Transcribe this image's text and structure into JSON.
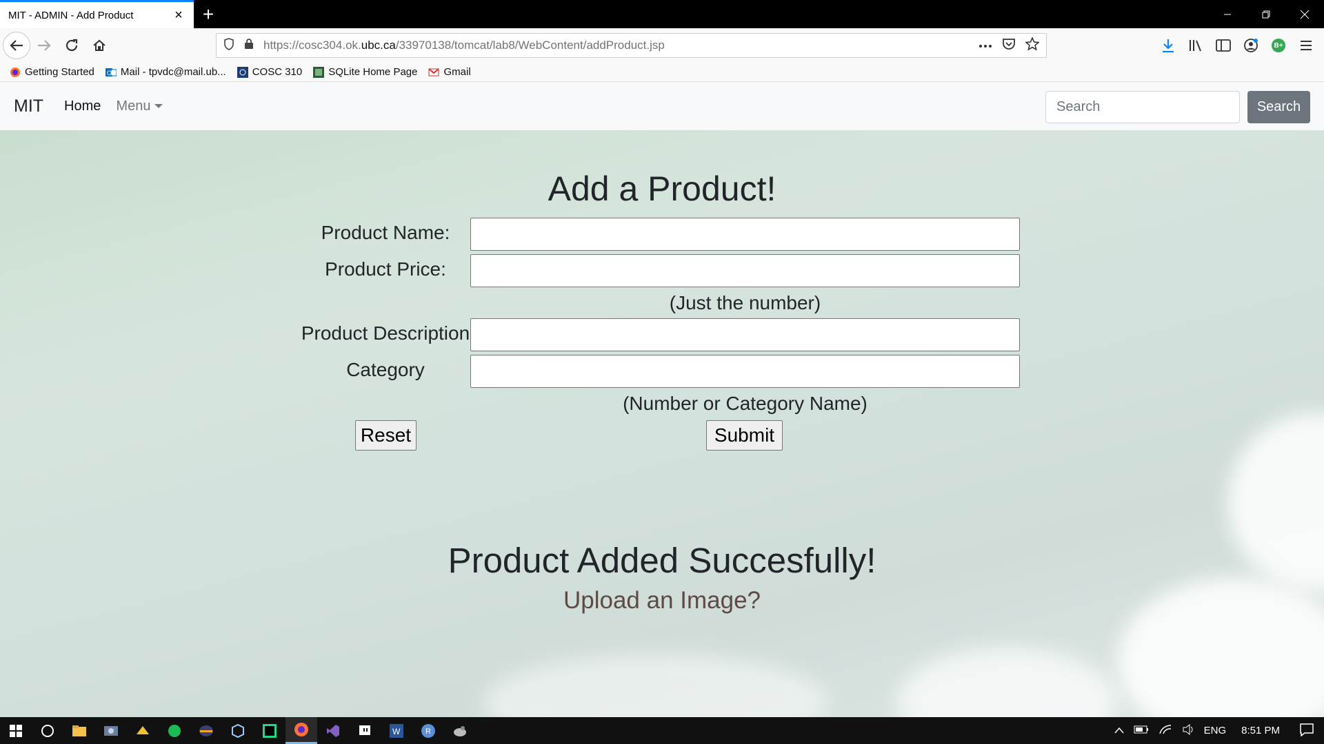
{
  "browser": {
    "tab_title": "MIT - ADMIN - Add Product",
    "url_prefix": "https://cosc304.ok.",
    "url_domain": "ubc.ca",
    "url_path": "/33970138/tomcat/lab8/WebContent/addProduct.jsp",
    "bookmarks": [
      {
        "label": "Getting Started",
        "icon": "firefox-icon"
      },
      {
        "label": "Mail - tpvdc@mail.ub...",
        "icon": "outlook-icon"
      },
      {
        "label": "COSC 310",
        "icon": "cosc-icon"
      },
      {
        "label": "SQLite Home Page",
        "icon": "sqlite-icon"
      },
      {
        "label": "Gmail",
        "icon": "gmail-icon"
      }
    ],
    "profile_badge": "B+"
  },
  "site_nav": {
    "brand": "MIT",
    "home": "Home",
    "menu": "Menu",
    "search_placeholder": "Search",
    "search_button": "Search"
  },
  "form": {
    "title": "Add a Product!",
    "name_label": "Product Name:",
    "price_label": "Product Price:",
    "price_hint": "(Just the number)",
    "description_label": "Product Description",
    "category_label": "Category",
    "category_hint": "(Number or Category Name)",
    "reset_button": "Reset",
    "submit_button": "Submit"
  },
  "result": {
    "message": "Product Added Succesfully!",
    "upload_link": "Upload an Image?"
  },
  "taskbar": {
    "language": "ENG",
    "time": "8:51 PM"
  },
  "colors": {
    "accent_tab": "#0a84ff",
    "search_button": "#6c757d",
    "upload_link": "#5e4a44"
  }
}
